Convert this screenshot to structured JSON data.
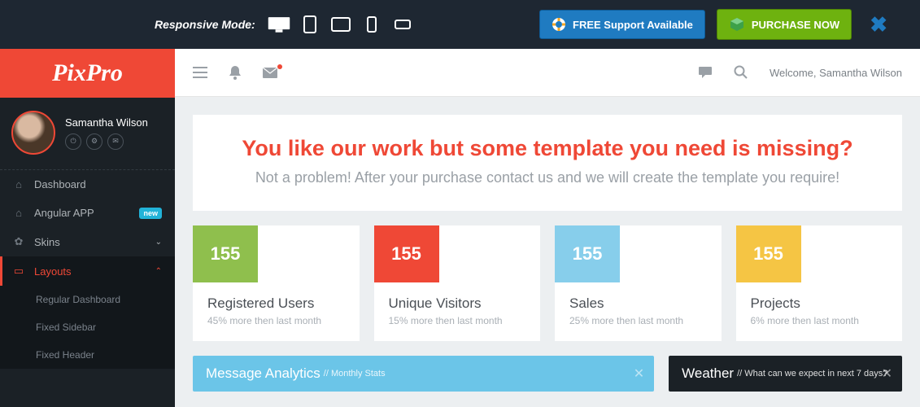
{
  "promo": {
    "label": "Responsive Mode:",
    "support_label": "FREE Support Available",
    "purchase_label": "PURCHASE NOW"
  },
  "brand": "PixPro",
  "user": {
    "name": "Samantha Wilson",
    "welcome": "Welcome, Samantha Wilson"
  },
  "nav": {
    "dashboard": "Dashboard",
    "angular": "Angular APP",
    "angular_badge": "new",
    "skins": "Skins",
    "layouts": "Layouts",
    "sub_regular": "Regular Dashboard",
    "sub_fixed_sidebar": "Fixed Sidebar",
    "sub_fixed_header": "Fixed Header"
  },
  "banner": {
    "title": "You like our work but some template you need is missing?",
    "subtitle": "Not a problem! After your purchase contact us and we will create the template you require!"
  },
  "stats": [
    {
      "value": "155",
      "title": "Registered Users",
      "sub": "45% more then last month",
      "color": "c0"
    },
    {
      "value": "155",
      "title": "Unique Visitors",
      "sub": "15% more then last month",
      "color": "c1"
    },
    {
      "value": "155",
      "title": "Sales",
      "sub": "25% more then last month",
      "color": "c2"
    },
    {
      "value": "155",
      "title": "Projects",
      "sub": "6% more then last month",
      "color": "c3"
    }
  ],
  "panels": {
    "analytics_title": "Message Analytics",
    "analytics_sub": "// Monthly Stats",
    "weather_title": "Weather",
    "weather_sub": "// What can we expect in next 7 days?"
  }
}
